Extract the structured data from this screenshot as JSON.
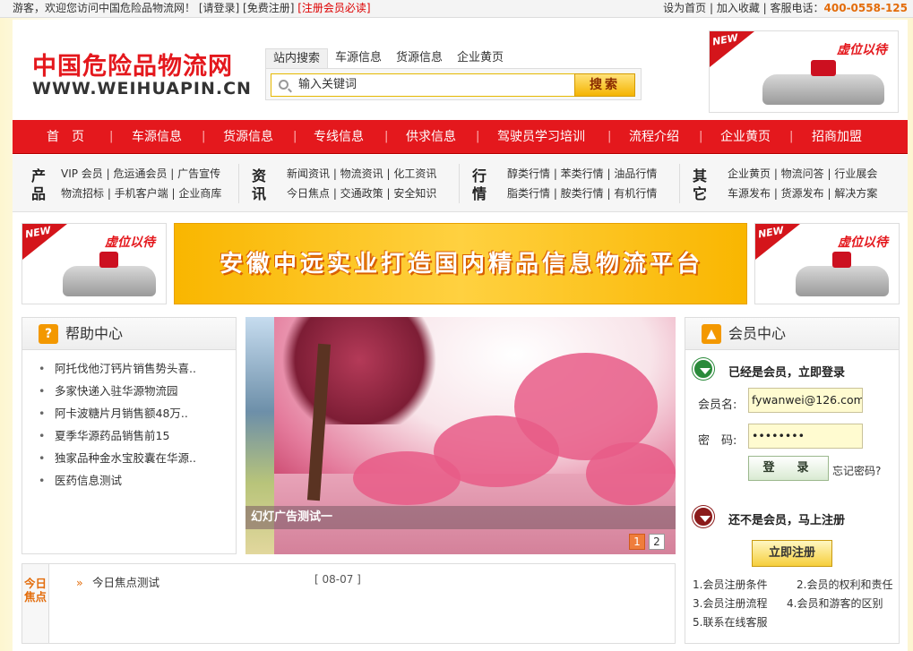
{
  "topbar": {
    "welcome": "游客，欢迎您访问中国危险品物流网！",
    "login": "[请登录]",
    "register": "[免费注册]",
    "must_read": "[注册会员必读]",
    "set_home": "设为首页",
    "favorite": "加入收藏",
    "hotline_label": "客服电话：",
    "hotline": "400-0558-125"
  },
  "header": {
    "logo_cn": "中国危险品物流网",
    "logo_en": "WWW.WEIHUAPIN.CN",
    "search": {
      "tabs": [
        "站内搜索",
        "车源信息",
        "货源信息",
        "企业黄页"
      ],
      "placeholder": "输入关键词",
      "button": "搜索"
    },
    "ad": {
      "new": "NEW",
      "text": "虚位以待"
    }
  },
  "nav": {
    "items": [
      "首　页",
      "车源信息",
      "货源信息",
      "专线信息",
      "供求信息",
      "驾驶员学习培训",
      "流程介绍",
      "企业黄页",
      "招商加盟"
    ],
    "separator": "|"
  },
  "categories": [
    {
      "head": "产品",
      "lines": [
        "VIP 会员 | 危运通会员 | 广告宣传",
        "物流招标 | 手机客户端 | 企业商库"
      ]
    },
    {
      "head": "资讯",
      "lines": [
        "新闻资讯 | 物流资讯 | 化工资讯",
        "今日焦点 | 交通政策 | 安全知识"
      ]
    },
    {
      "head": "行情",
      "lines": [
        "醇类行情 | 苯类行情 | 油品行情",
        "脂类行情 | 胺类行情 | 有机行情"
      ]
    },
    {
      "head": "其它",
      "lines": [
        "企业黄页 | 物流问答 | 行业展会",
        "车源发布 | 货源发布 | 解决方案"
      ]
    }
  ],
  "banner": {
    "text": "安徽中远实业打造国内精品信息物流平台"
  },
  "side_ads": {
    "new": "NEW",
    "text": "虚位以待"
  },
  "help": {
    "title": "帮助中心",
    "items": [
      "阿托伐他汀钙片销售势头喜..",
      "多家快递入驻华源物流园",
      "阿卡波糖片月销售额48万..",
      "夏季华源药品销售前15",
      "独家品种金水宝胶囊在华源..",
      "医药信息测试"
    ]
  },
  "slideshow": {
    "caption": "幻灯广告测试一",
    "pages": [
      "1",
      "2"
    ],
    "active_page": "1"
  },
  "member": {
    "title": "会员中心",
    "login_heading": "已经是会员，立即登录",
    "username_label": "会员名:",
    "username_value": "fywanwei@126.com",
    "password_label": "密　码:",
    "password_value": "••••••••",
    "login_button": "登　录",
    "forgot": "忘记密码?",
    "register_heading": "还不是会员，马上注册",
    "register_button": "立即注册",
    "links": [
      "1.会员注册条件",
      "2.会员的权利和责任",
      "3.会员注册流程",
      "4.会员和游客的区别",
      "5.联系在线客服"
    ]
  },
  "today": {
    "tab": "今日焦点",
    "item": "今日焦点测试",
    "date": "[ 08-07 ]"
  }
}
